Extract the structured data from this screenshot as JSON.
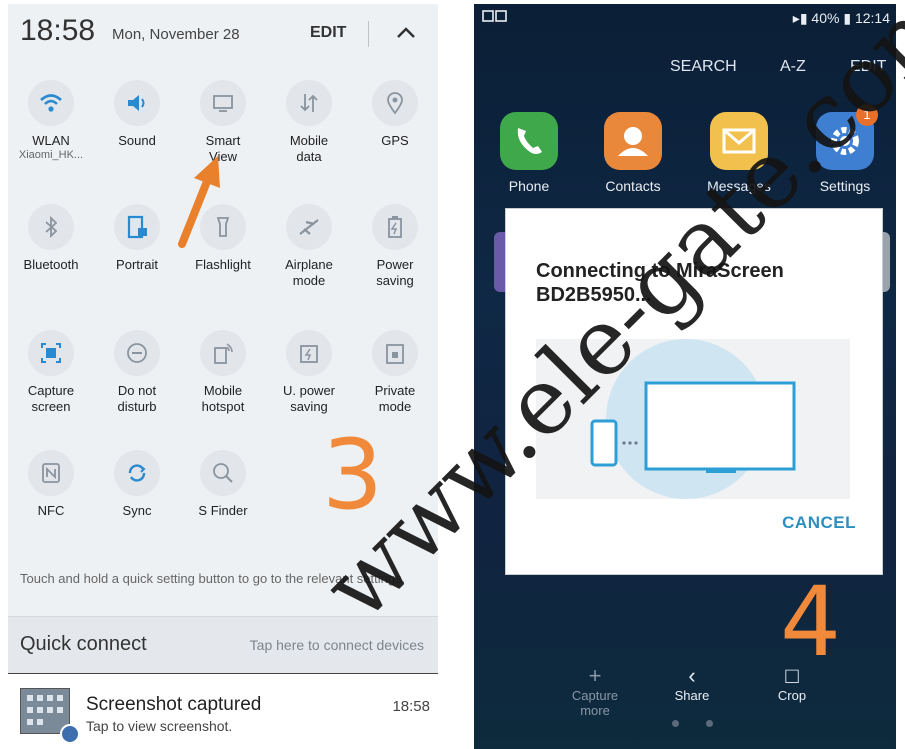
{
  "left": {
    "time": "18:58",
    "date": "Mon, November 28",
    "edit": "EDIT",
    "tiles": [
      {
        "label": "WLAN",
        "sub": "Xiaomi_HK...",
        "icon": "wifi-icon",
        "active": true
      },
      {
        "label": "Sound",
        "sub": "",
        "icon": "volume-icon",
        "active": true
      },
      {
        "label": "Smart\nView",
        "sub": "",
        "icon": "smart-view-icon",
        "active": false
      },
      {
        "label": "Mobile\ndata",
        "sub": "",
        "icon": "mobile-data-icon",
        "active": false
      },
      {
        "label": "GPS",
        "sub": "",
        "icon": "location-pin-icon",
        "active": false
      },
      {
        "label": "Bluetooth",
        "sub": "",
        "icon": "bluetooth-icon",
        "active": false
      },
      {
        "label": "Portrait",
        "sub": "",
        "icon": "portrait-lock-icon",
        "active": true
      },
      {
        "label": "Flashlight",
        "sub": "",
        "icon": "flashlight-icon",
        "active": false
      },
      {
        "label": "Airplane\nmode",
        "sub": "",
        "icon": "airplane-icon",
        "active": false
      },
      {
        "label": "Power\nsaving",
        "sub": "",
        "icon": "battery-icon",
        "active": false
      },
      {
        "label": "Capture\nscreen",
        "sub": "",
        "icon": "capture-screen-icon",
        "active": true
      },
      {
        "label": "Do not\ndisturb",
        "sub": "",
        "icon": "do-not-disturb-icon",
        "active": false
      },
      {
        "label": "Mobile\nhotspot",
        "sub": "",
        "icon": "hotspot-icon",
        "active": false
      },
      {
        "label": "U. power\nsaving",
        "sub": "",
        "icon": "ultra-power-icon",
        "active": false
      },
      {
        "label": "Private\nmode",
        "sub": "",
        "icon": "private-mode-icon",
        "active": false
      },
      {
        "label": "NFC",
        "sub": "",
        "icon": "nfc-icon",
        "active": false
      },
      {
        "label": "Sync",
        "sub": "",
        "icon": "sync-icon",
        "active": true
      },
      {
        "label": "S Finder",
        "sub": "",
        "icon": "search-icon",
        "active": false
      }
    ],
    "hint": "Touch and hold a quick setting button to go to the relevant settings.",
    "quick_connect": {
      "title": "Quick connect",
      "hint": "Tap here to connect devices"
    },
    "notification": {
      "title": "Screenshot captured",
      "subtitle": "Tap to view screenshot.",
      "time": "18:58"
    },
    "step_number": "3"
  },
  "right": {
    "status": {
      "battery": "40%",
      "time": "12:14"
    },
    "toolbar": {
      "search": "SEARCH",
      "az": "A-Z",
      "edit": "EDIT"
    },
    "apps": [
      {
        "label": "Phone",
        "color": "#3ea84a"
      },
      {
        "label": "Contacts",
        "color": "#e9873b"
      },
      {
        "label": "Messages",
        "color": "#f2c04d"
      },
      {
        "label": "Settings",
        "color": "#3f7fd1",
        "badge": "1"
      }
    ],
    "dialog": {
      "title": "Connecting to MiraScreen BD2B5950...",
      "cancel": "CANCEL"
    },
    "actions": {
      "capture_more": "Capture\nmore",
      "share": "Share",
      "crop": "Crop"
    },
    "step_number": "4"
  },
  "watermark": "www.ele-gate.com",
  "colors": {
    "accent": "#2d8fbf",
    "annotation": "#f08a3a",
    "tile_active": "#2a8ad0"
  }
}
